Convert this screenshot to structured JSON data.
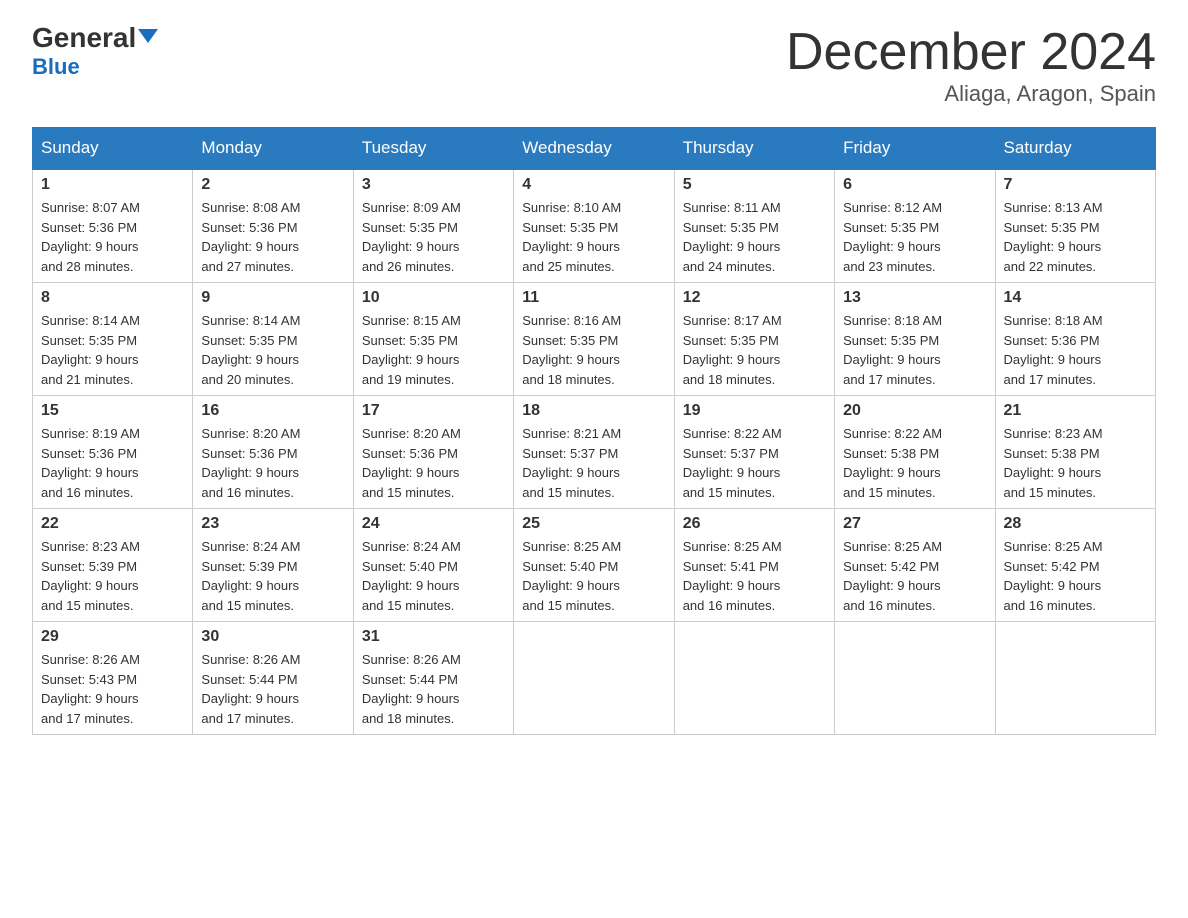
{
  "logo": {
    "text_general": "General",
    "text_blue": "Blue"
  },
  "title": {
    "month_year": "December 2024",
    "location": "Aliaga, Aragon, Spain"
  },
  "weekdays": [
    "Sunday",
    "Monday",
    "Tuesday",
    "Wednesday",
    "Thursday",
    "Friday",
    "Saturday"
  ],
  "weeks": [
    [
      {
        "day": "1",
        "sunrise": "8:07 AM",
        "sunset": "5:36 PM",
        "daylight": "9 hours and 28 minutes."
      },
      {
        "day": "2",
        "sunrise": "8:08 AM",
        "sunset": "5:36 PM",
        "daylight": "9 hours and 27 minutes."
      },
      {
        "day": "3",
        "sunrise": "8:09 AM",
        "sunset": "5:35 PM",
        "daylight": "9 hours and 26 minutes."
      },
      {
        "day": "4",
        "sunrise": "8:10 AM",
        "sunset": "5:35 PM",
        "daylight": "9 hours and 25 minutes."
      },
      {
        "day": "5",
        "sunrise": "8:11 AM",
        "sunset": "5:35 PM",
        "daylight": "9 hours and 24 minutes."
      },
      {
        "day": "6",
        "sunrise": "8:12 AM",
        "sunset": "5:35 PM",
        "daylight": "9 hours and 23 minutes."
      },
      {
        "day": "7",
        "sunrise": "8:13 AM",
        "sunset": "5:35 PM",
        "daylight": "9 hours and 22 minutes."
      }
    ],
    [
      {
        "day": "8",
        "sunrise": "8:14 AM",
        "sunset": "5:35 PM",
        "daylight": "9 hours and 21 minutes."
      },
      {
        "day": "9",
        "sunrise": "8:14 AM",
        "sunset": "5:35 PM",
        "daylight": "9 hours and 20 minutes."
      },
      {
        "day": "10",
        "sunrise": "8:15 AM",
        "sunset": "5:35 PM",
        "daylight": "9 hours and 19 minutes."
      },
      {
        "day": "11",
        "sunrise": "8:16 AM",
        "sunset": "5:35 PM",
        "daylight": "9 hours and 18 minutes."
      },
      {
        "day": "12",
        "sunrise": "8:17 AM",
        "sunset": "5:35 PM",
        "daylight": "9 hours and 18 minutes."
      },
      {
        "day": "13",
        "sunrise": "8:18 AM",
        "sunset": "5:35 PM",
        "daylight": "9 hours and 17 minutes."
      },
      {
        "day": "14",
        "sunrise": "8:18 AM",
        "sunset": "5:36 PM",
        "daylight": "9 hours and 17 minutes."
      }
    ],
    [
      {
        "day": "15",
        "sunrise": "8:19 AM",
        "sunset": "5:36 PM",
        "daylight": "9 hours and 16 minutes."
      },
      {
        "day": "16",
        "sunrise": "8:20 AM",
        "sunset": "5:36 PM",
        "daylight": "9 hours and 16 minutes."
      },
      {
        "day": "17",
        "sunrise": "8:20 AM",
        "sunset": "5:36 PM",
        "daylight": "9 hours and 15 minutes."
      },
      {
        "day": "18",
        "sunrise": "8:21 AM",
        "sunset": "5:37 PM",
        "daylight": "9 hours and 15 minutes."
      },
      {
        "day": "19",
        "sunrise": "8:22 AM",
        "sunset": "5:37 PM",
        "daylight": "9 hours and 15 minutes."
      },
      {
        "day": "20",
        "sunrise": "8:22 AM",
        "sunset": "5:38 PM",
        "daylight": "9 hours and 15 minutes."
      },
      {
        "day": "21",
        "sunrise": "8:23 AM",
        "sunset": "5:38 PM",
        "daylight": "9 hours and 15 minutes."
      }
    ],
    [
      {
        "day": "22",
        "sunrise": "8:23 AM",
        "sunset": "5:39 PM",
        "daylight": "9 hours and 15 minutes."
      },
      {
        "day": "23",
        "sunrise": "8:24 AM",
        "sunset": "5:39 PM",
        "daylight": "9 hours and 15 minutes."
      },
      {
        "day": "24",
        "sunrise": "8:24 AM",
        "sunset": "5:40 PM",
        "daylight": "9 hours and 15 minutes."
      },
      {
        "day": "25",
        "sunrise": "8:25 AM",
        "sunset": "5:40 PM",
        "daylight": "9 hours and 15 minutes."
      },
      {
        "day": "26",
        "sunrise": "8:25 AM",
        "sunset": "5:41 PM",
        "daylight": "9 hours and 16 minutes."
      },
      {
        "day": "27",
        "sunrise": "8:25 AM",
        "sunset": "5:42 PM",
        "daylight": "9 hours and 16 minutes."
      },
      {
        "day": "28",
        "sunrise": "8:25 AM",
        "sunset": "5:42 PM",
        "daylight": "9 hours and 16 minutes."
      }
    ],
    [
      {
        "day": "29",
        "sunrise": "8:26 AM",
        "sunset": "5:43 PM",
        "daylight": "9 hours and 17 minutes."
      },
      {
        "day": "30",
        "sunrise": "8:26 AM",
        "sunset": "5:44 PM",
        "daylight": "9 hours and 17 minutes."
      },
      {
        "day": "31",
        "sunrise": "8:26 AM",
        "sunset": "5:44 PM",
        "daylight": "9 hours and 18 minutes."
      },
      null,
      null,
      null,
      null
    ]
  ],
  "labels": {
    "sunrise": "Sunrise:",
    "sunset": "Sunset:",
    "daylight": "Daylight:"
  }
}
